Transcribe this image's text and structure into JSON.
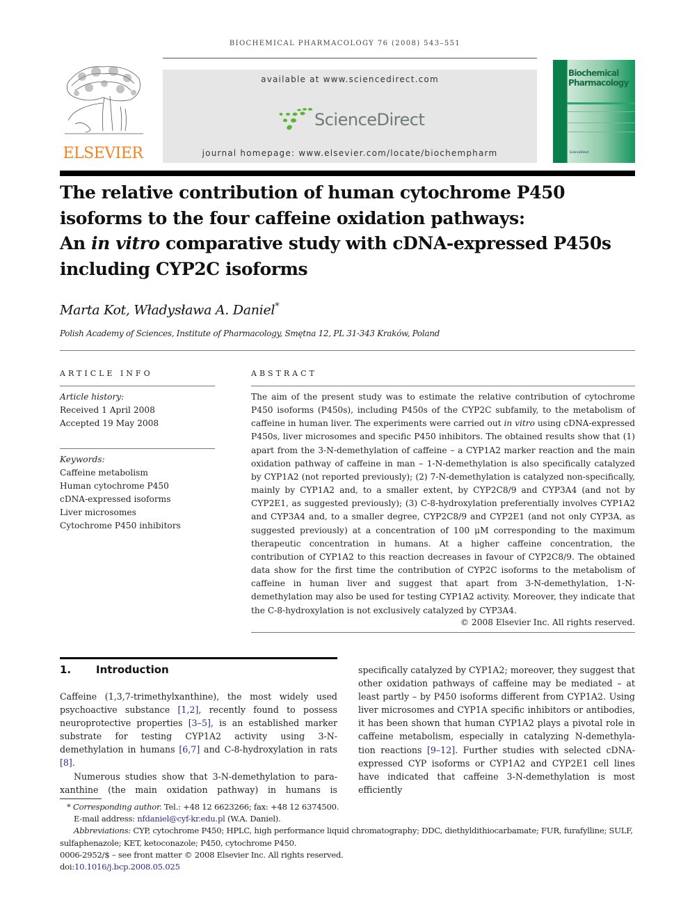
{
  "journal": {
    "running_head": "BIOCHEMICAL PHARMACOLOGY 76 (2008) 543–551",
    "publisher_logo_text": "ELSEVIER",
    "banner": {
      "available_at": "available at www.sciencedirect.com",
      "sciencedirect_logo": "ScienceDirect",
      "homepage": "journal homepage: www.elsevier.com/locate/biochempharm"
    },
    "cover": {
      "title_line1": "Biochemical",
      "title_line2": "Pharmacology",
      "footer_logo": "ScienceDirect"
    },
    "colors": {
      "elsevier_orange": "#f58220",
      "sciencedirect_green": "#5cb531",
      "cover_green": "#0c8a53",
      "link_blue": "#2a2a86"
    }
  },
  "article": {
    "title_line1": "The relative contribution of human cytochrome P450",
    "title_line2": "isoforms to the four caffeine oxidation pathways:",
    "title_line3_pre": "An ",
    "title_line3_italic": "in vitro",
    "title_line3_post": " comparative study with cDNA-expressed P450s",
    "title_line4": "including CYP2C isoforms",
    "authors": "Marta Kot, Władysława A. Daniel",
    "author_mark": "*",
    "affiliation": "Polish Academy of Sciences, Institute of Pharmacology, Smętna 12, PL 31-343 Kraków, Poland"
  },
  "article_info": {
    "heading": "ARTICLE INFO",
    "history_label": "Article history:",
    "received": "Received 1 April 2008",
    "accepted": "Accepted 19 May 2008",
    "keywords_label": "Keywords:",
    "keywords": [
      "Caffeine metabolism",
      "Human cytochrome P450",
      "cDNA-expressed isoforms",
      "Liver microsomes",
      "Cytochrome P450 inhibitors"
    ]
  },
  "abstract": {
    "heading": "ABSTRACT",
    "part1": "The aim of the present study was to estimate the relative contribution of cytochrome P450 isoforms (P450s), including P450s of the CYP2C subfamily, to the metabolism of caffeine in human liver. The experiments were carried out ",
    "italic1": "in vitro",
    "part2": " using cDNA-expressed P450s, liver microsomes and specific P450 inhibitors. The obtained results show that (1) apart from the 3-N-demethylation of caffeine – a CYP1A2 marker reaction and the main oxidation pathway of caffeine in man – 1-N-demethylation is also specifically catalyzed by CYP1A2 (not reported previously); (2) 7-N-demethylation is catalyzed non-specifically, mainly by CYP1A2 and, to a smaller extent, by CYP2C8/9 and CYP3A4 (and not by CYP2E1, as suggested previously); (3) C-8-hydroxylation preferentially involves CYP1A2 and CYP3A4 and, to a smaller degree, CYP2C8/9 and CYP2E1 (and not only CYP3A, as suggested previously) at a concentration of 100 μM corresponding to the maximum therapeutic concentration in humans. At a higher caffeine concentration, the contribution of CYP1A2 to this reaction decreases in favour of CYP2C8/9. The obtained data show for the first time the contribution of CYP2C isoforms to the metabolism of caffeine in human liver and suggest that apart from 3-N-demethylation, 1-N-demethylation may also be used for testing CYP1A2 activity. Moreover, they indicate that the C-8-hydroxylation is not exclusively catalyzed by CYP3A4.",
    "copyright": "© 2008 Elsevier Inc. All rights reserved."
  },
  "introduction": {
    "number": "1.",
    "heading": "Introduction",
    "p1_a": "Caffeine (1,3,7-trimethylxanthine), the most widely used psychoactive substance ",
    "p1_ref1": "[1,2]",
    "p1_b": ", recently found to possess neuroprotective properties ",
    "p1_ref2": "[3–5]",
    "p1_c": ", is an established marker substrate for testing CYP1A2 activity using 3-N-demethylation in humans ",
    "p1_ref3": "[6,7]",
    "p1_d": " and C-8-hydroxylation in rats ",
    "p1_ref4": "[8]",
    "p1_e": ".",
    "p2_left": "Numerous studies show that 3-N-demethylation to para-xanthine (the main oxidation pathway) in humans is",
    "p2_right_a": "specifically catalyzed by CYP1A2; moreover, they suggest that other oxidation pathways of caffeine may be mediated – at least partly – by P450 isoforms different from CYP1A2. Using liver microsomes and CYP1A specific inhibitors or antibodies, it has been shown that human CYP1A2 plays a pivotal role in caffeine metabolism, especially in catalyzing N-demethyla-tion reactions ",
    "p2_ref": "[9–12]",
    "p2_right_b": ". Further studies with selected cDNA-expressed CYP isoforms or CYP1A2 and CYP2E1 cell lines have indicated that caffeine 3-N-demethylation is most efficiently"
  },
  "footnotes": {
    "mark": "*",
    "corresponding_label": "Corresponding author.",
    "contact": " Tel.: +48 12 6623266; fax: +48 12 6374500.",
    "email_label": "E-mail address: ",
    "email": "nfdaniel@cyf-kr.edu.pl",
    "email_owner": " (W.A. Daniel).",
    "abbrev_label": "Abbreviations:",
    "abbrev_text": "  CYP, cytochrome P450; HPLC, high performance liquid chromatography; DDC, diethyldithiocarbamate; FUR, furafylline; SULF, sulfaphenazole; KET, ketoconazole; P450, cytochrome P450.",
    "front_matter": "0006-2952/$ – see front matter © 2008 Elsevier Inc. All rights reserved.",
    "doi_label": "doi:",
    "doi": "10.1016/j.bcp.2008.05.025"
  }
}
